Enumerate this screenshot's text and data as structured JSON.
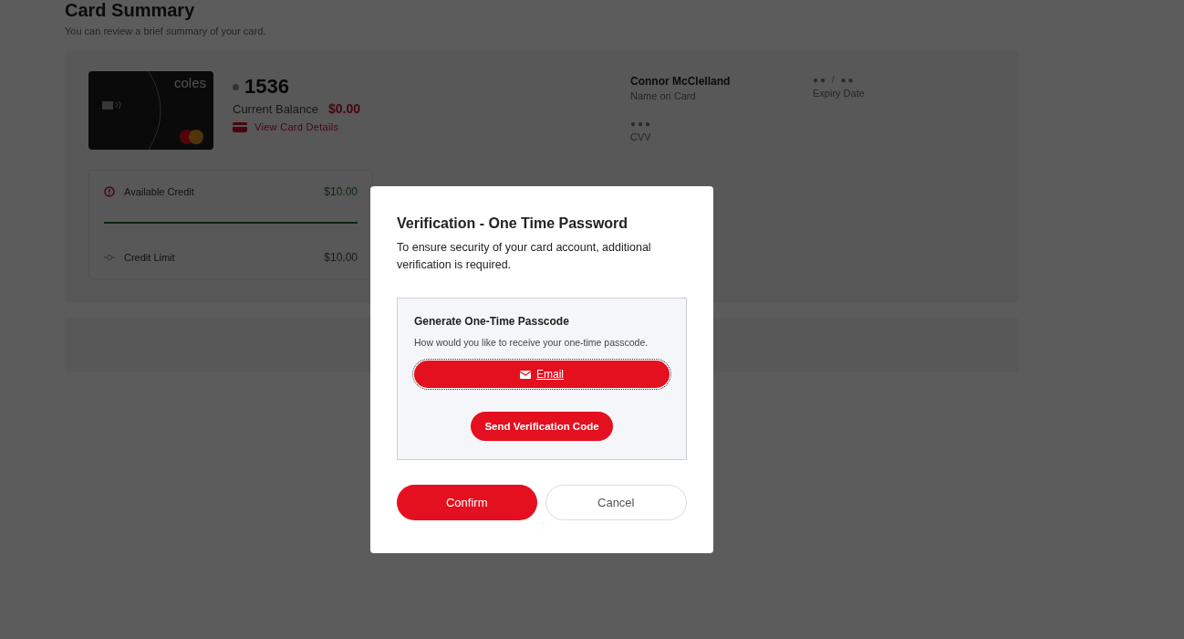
{
  "page": {
    "title": "Card Summary",
    "subtitle": "You can review a brief summary of your card."
  },
  "card": {
    "brand": "coles",
    "masked_number": "1536",
    "balance_label": "Current Balance",
    "balance": "$0.00",
    "details_link": "View Card Details",
    "name": "Connor McClelland",
    "name_label": "Name on Card",
    "expiry": "●● / ●●",
    "expiry_label": "Expiry Date",
    "cvv": "●●●",
    "cvv_label": "CVV"
  },
  "credit": {
    "available_label": "Available Credit",
    "available": "$10.00",
    "level": 1,
    "limit_label": "Credit Limit",
    "limit": "$10.00"
  },
  "dialog": {
    "title": "Verification - One Time Password",
    "message": "To ensure security of your card account, additional verification is required.",
    "section_title": "Generate One-Time Passcode",
    "section_hint": "How would you like to receive your one-time passcode.",
    "options": [
      {
        "label": "Email",
        "selected": true
      }
    ],
    "send_button": "Send Verification Code",
    "confirm_button": "Confirm",
    "cancel_button": "Cancel"
  }
}
